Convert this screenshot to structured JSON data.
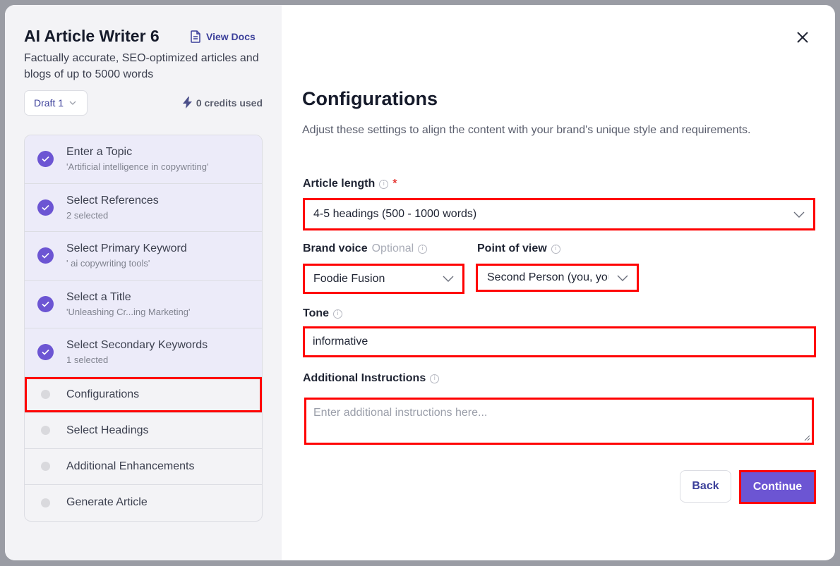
{
  "app": {
    "title": "AI Article Writer 6",
    "view_docs_label": "View Docs",
    "subtitle": "Factually accurate, SEO-optimized articles and blogs of up to 5000 words",
    "draft_label": "Draft 1",
    "credits_label": "0 credits used"
  },
  "steps": [
    {
      "title": "Enter a Topic",
      "subtitle": "'Artificial intelligence in copywriting'",
      "status": "done"
    },
    {
      "title": "Select References",
      "subtitle": "2 selected",
      "status": "done"
    },
    {
      "title": "Select Primary Keyword",
      "subtitle": "' ai copywriting tools'",
      "status": "done"
    },
    {
      "title": "Select a Title",
      "subtitle": "'Unleashing Cr...ing Marketing'",
      "status": "done"
    },
    {
      "title": "Select Secondary Keywords",
      "subtitle": "1 selected",
      "status": "done"
    },
    {
      "title": "Configurations",
      "status": "active"
    },
    {
      "title": "Select Headings",
      "status": "pending"
    },
    {
      "title": "Additional Enhancements",
      "status": "pending"
    },
    {
      "title": "Generate Article",
      "status": "pending"
    }
  ],
  "config": {
    "title": "Configurations",
    "description": "Adjust these settings to align the content with your brand's unique style and requirements.",
    "article_length": {
      "label": "Article length",
      "required_mark": "*",
      "value": "4-5 headings (500 - 1000 words)"
    },
    "brand_voice": {
      "label": "Brand voice",
      "optional_label": "Optional",
      "value": "Foodie Fusion"
    },
    "point_of_view": {
      "label": "Point of view",
      "value": "Second Person (you, your)"
    },
    "tone": {
      "label": "Tone",
      "value": "informative"
    },
    "additional_instructions": {
      "label": "Additional Instructions",
      "placeholder": "Enter additional instructions here..."
    },
    "back_label": "Back",
    "continue_label": "Continue"
  },
  "colors": {
    "accent": "#6c55d3",
    "highlight": "#ff0000",
    "sidebar_bg": "#f3f3f6"
  }
}
